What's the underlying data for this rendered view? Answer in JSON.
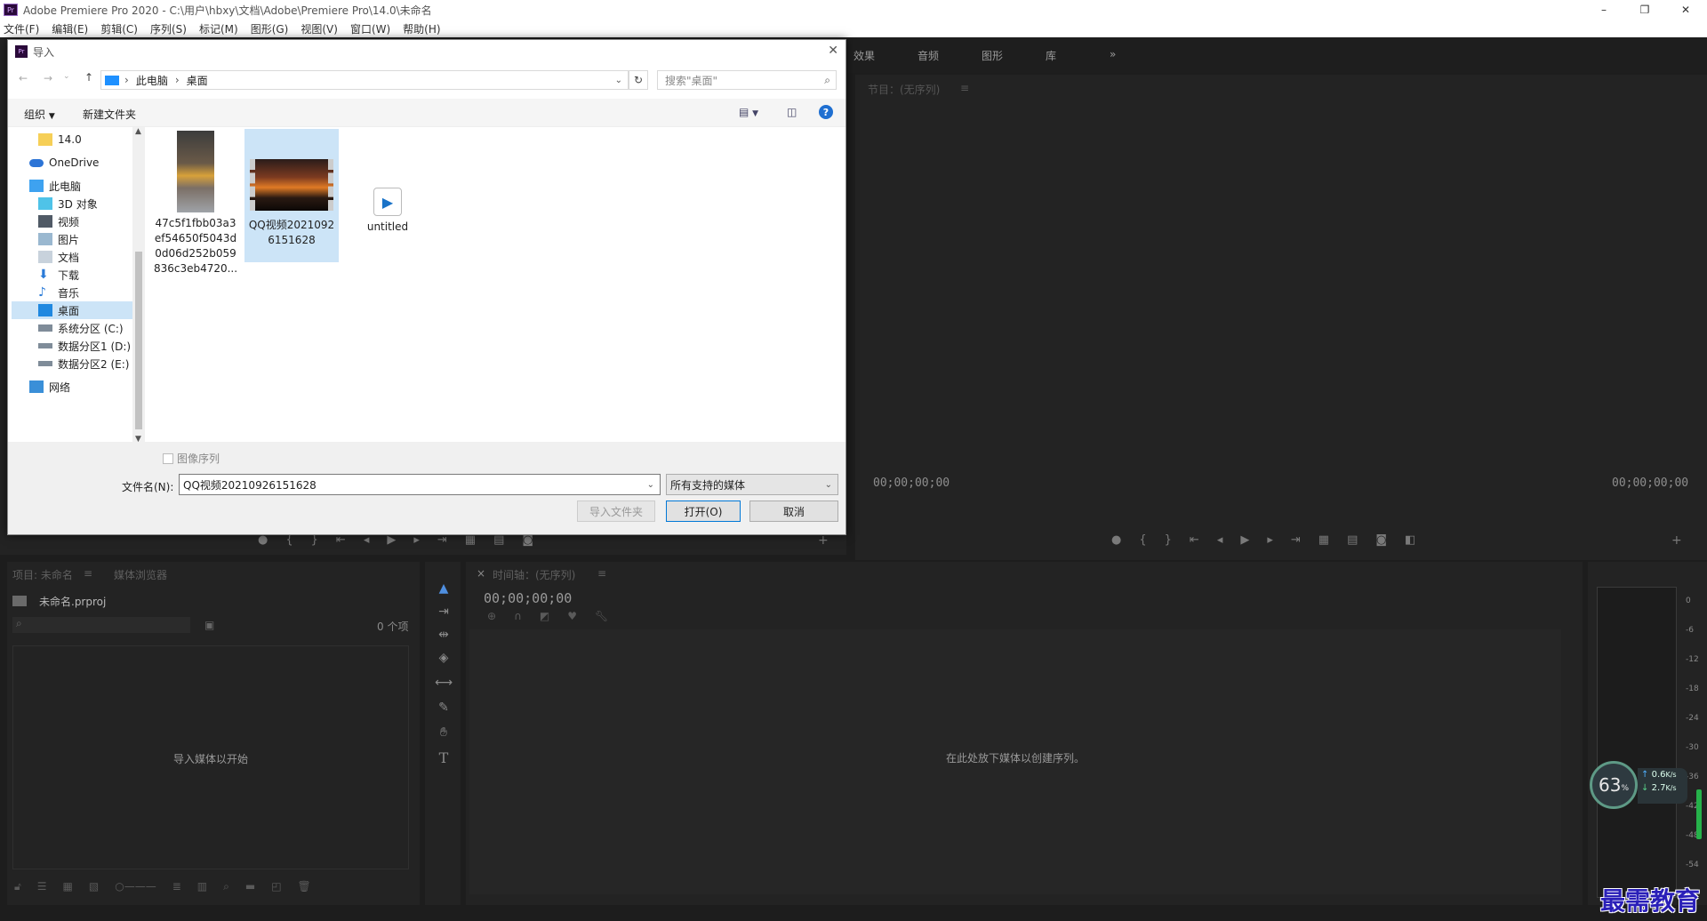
{
  "window": {
    "title": "Adobe Premiere Pro 2020 - C:\\用户\\hbxy\\文档\\Adobe\\Premiere Pro\\14.0\\未命名",
    "minimize": "–",
    "maximize": "❐",
    "close": "✕"
  },
  "menu": [
    "文件(F)",
    "编辑(E)",
    "剪辑(C)",
    "序列(S)",
    "标记(M)",
    "图形(G)",
    "视图(V)",
    "窗口(W)",
    "帮助(H)"
  ],
  "top_tabs": [
    "效果",
    "音频",
    "图形",
    "库"
  ],
  "program": {
    "title": "节目：(无序列)",
    "tc_left": "00;00;00;00",
    "tc_right": "00;00;00;00"
  },
  "project": {
    "tab1": "项目: 未命名",
    "tab2": "媒体浏览器",
    "file": "未命名.prproj",
    "count": "0 个项",
    "empty": "导入媒体以开始"
  },
  "timeline": {
    "tab": "时间轴：(无序列)",
    "tc": "00;00;00;00",
    "empty": "在此处放下媒体以创建序列。"
  },
  "meter_scale": [
    "0",
    "-6",
    "-12",
    "-18",
    "-24",
    "-30",
    "-36",
    "-42",
    "-48",
    "-54"
  ],
  "netwidget": {
    "percent": "63",
    "unit": "%",
    "up": "0.6",
    "up_unit": "K/s",
    "down": "2.7",
    "down_unit": "K/s"
  },
  "watermark": "最需教育",
  "dialog": {
    "title": "导入",
    "path": [
      "此电脑",
      "桌面"
    ],
    "search_placeholder": "搜索\"桌面\"",
    "organize": "组织",
    "new_folder": "新建文件夹",
    "nav": [
      {
        "label": "14.0",
        "icon": "folder-icon"
      },
      {
        "label": "OneDrive",
        "icon": "cloud-icon"
      },
      {
        "label": "此电脑",
        "icon": "computer-icon"
      },
      {
        "label": "3D 对象",
        "icon": "cube-icon"
      },
      {
        "label": "视频",
        "icon": "video-icon"
      },
      {
        "label": "图片",
        "icon": "picture-icon"
      },
      {
        "label": "文档",
        "icon": "document-icon"
      },
      {
        "label": "下载",
        "icon": "download-icon"
      },
      {
        "label": "音乐",
        "icon": "music-icon"
      },
      {
        "label": "桌面",
        "icon": "desktop-icon"
      },
      {
        "label": "系统分区 (C:)",
        "icon": "drive-icon"
      },
      {
        "label": "数据分区1 (D:)",
        "icon": "drive-icon"
      },
      {
        "label": "数据分区2 (E:)",
        "icon": "drive-icon"
      },
      {
        "label": "网络",
        "icon": "network-icon"
      }
    ],
    "files": [
      {
        "name": "47c5f1fbb03a3ef54650f5043d0d06d252b059836c3eb4720..."
      },
      {
        "name": "QQ视频20210926151628"
      },
      {
        "name": "untitled"
      }
    ],
    "image_sequence": "图像序列",
    "filename_label": "文件名(N):",
    "filename_value": "QQ视频20210926151628",
    "filetype": "所有支持的媒体",
    "import_folder": "导入文件夹",
    "open": "打开(O)",
    "cancel": "取消"
  }
}
